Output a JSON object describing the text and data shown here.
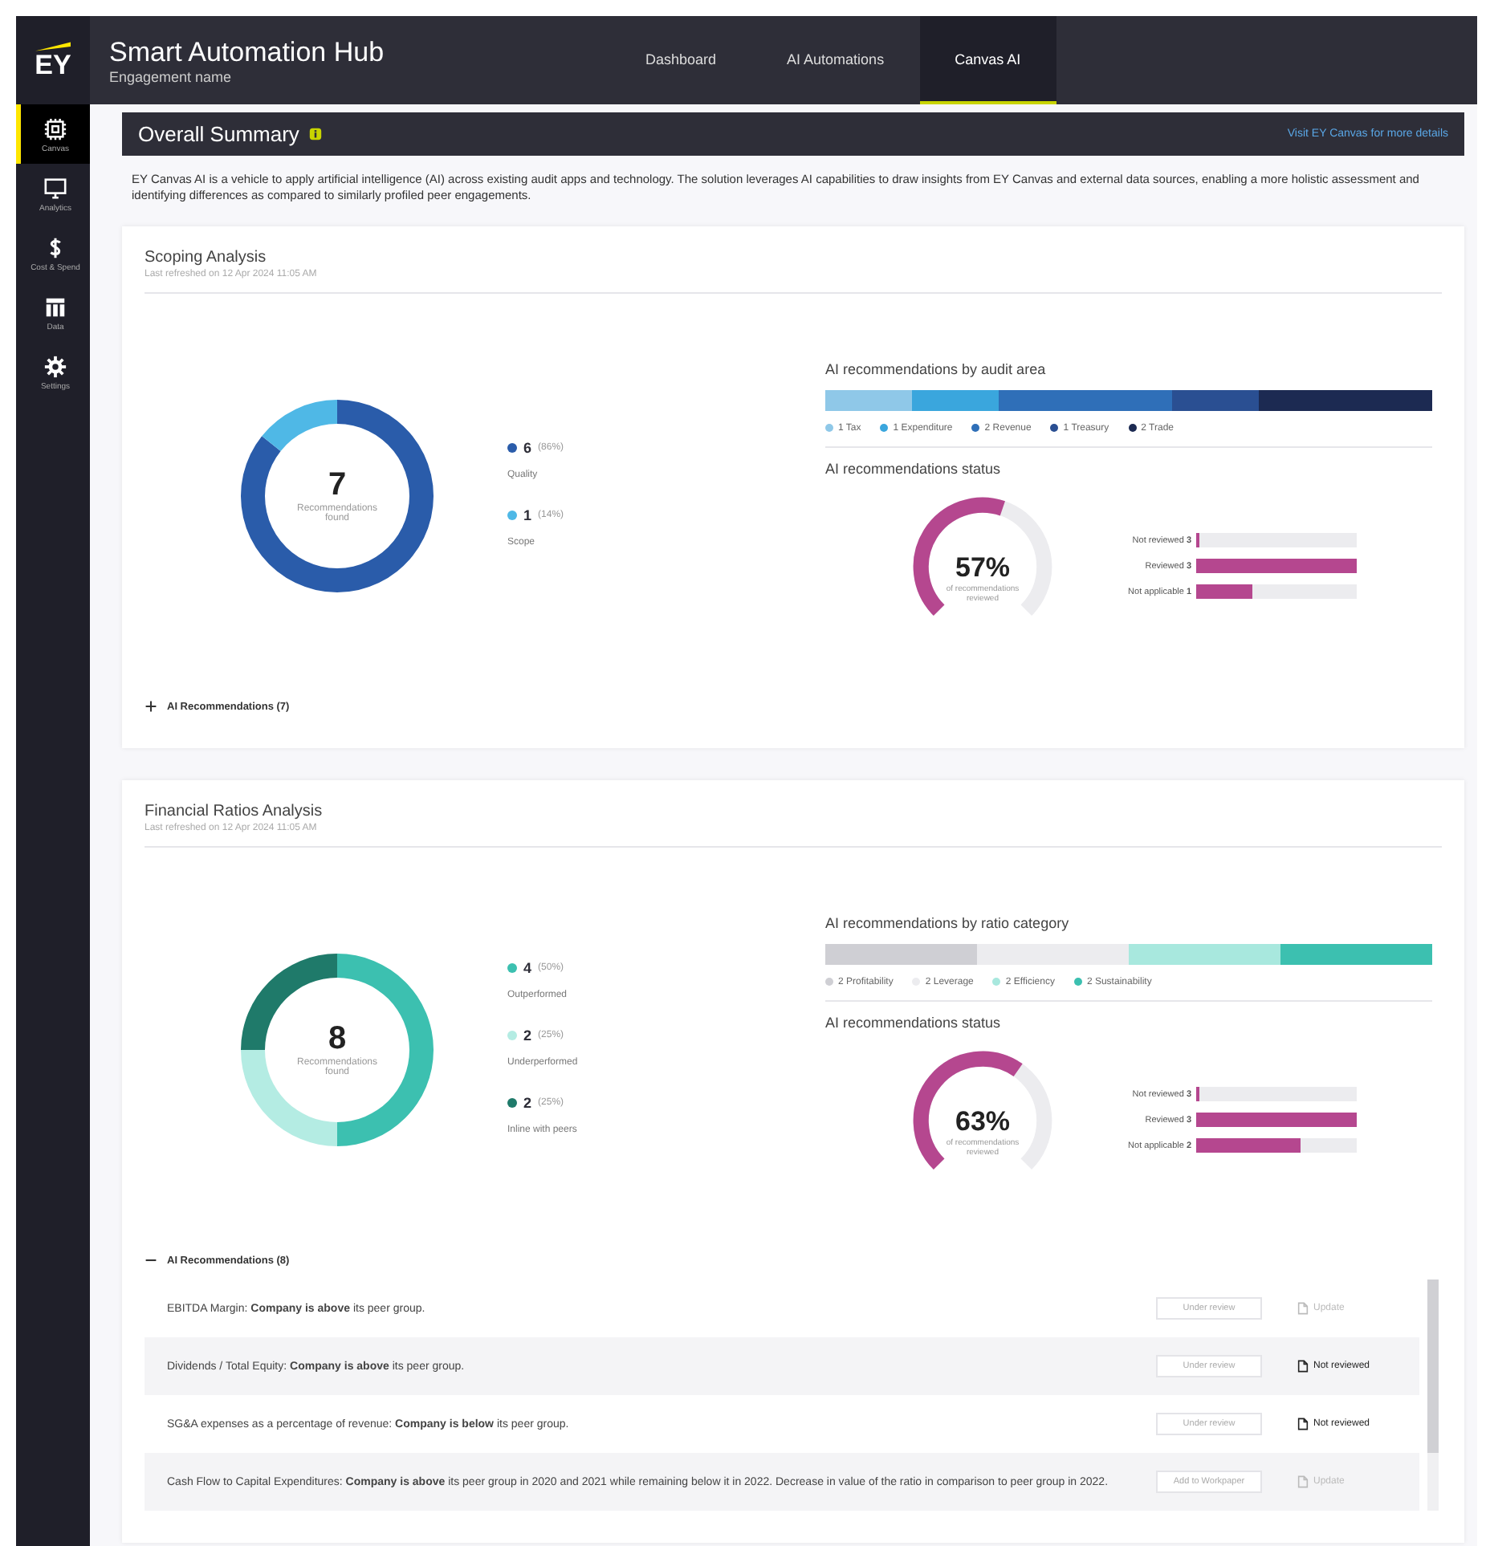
{
  "header": {
    "logo": "EY",
    "title": "Smart Automation Hub",
    "subtitle": "Engagement name",
    "tabs": [
      {
        "label": "Dashboard",
        "selected": false
      },
      {
        "label": "AI Automations",
        "selected": false
      },
      {
        "label": "Canvas AI",
        "selected": true
      }
    ]
  },
  "sidebar": {
    "items": [
      {
        "kind": "grid",
        "label": "Canvas",
        "selected": true
      },
      {
        "kind": "monitor",
        "label": "Analytics",
        "selected": false
      },
      {
        "kind": "dollar",
        "label": "Cost & Spend",
        "selected": false
      },
      {
        "kind": "table",
        "label": "Data",
        "selected": false
      },
      {
        "kind": "gear",
        "label": "Settings",
        "selected": false
      }
    ]
  },
  "summary": {
    "title": "Overall Summary",
    "link": "Visit EY Canvas for more details",
    "description": "EY Canvas AI is a vehicle to apply artificial intelligence (AI) across existing audit apps and technology. The solution leverages AI capabilities to draw insights from EY Canvas and external data sources, enabling a more holistic assessment and identifying differences as compared to similarly profiled peer engagements."
  },
  "sections": [
    {
      "title": "Scoping Analysis",
      "subtitle": "Last refreshed on 12 Apr 2024 11:05 AM",
      "donut": {
        "total": "7",
        "caption": "Recommendations found",
        "legend": [
          {
            "count": "6",
            "percent": "(86%)",
            "label": "Quality",
            "color": "#2a5caa"
          },
          {
            "count": "1",
            "percent": "(14%)",
            "label": "Scope",
            "color": "#4fb8e6"
          }
        ]
      },
      "category_chart": {
        "title": "AI recommendations by audit area",
        "legend": [
          {
            "count": "1",
            "label": "Tax",
            "color": "#8fc8e8"
          },
          {
            "count": "1",
            "label": "Expenditure",
            "color": "#3aa6dd"
          },
          {
            "count": "2",
            "label": "Revenue",
            "color": "#2f6fb8"
          },
          {
            "count": "1",
            "label": "Treasury",
            "color": "#2a4f92"
          },
          {
            "count": "2",
            "label": "Trade",
            "color": "#1c2a52"
          }
        ]
      },
      "status": {
        "title": "AI recommendations status",
        "percent": "57%",
        "caption": "of recommendations reviewed",
        "bars": [
          {
            "label": "Not reviewed",
            "count": "3",
            "level": 0.02
          },
          {
            "label": "Reviewed",
            "count": "3",
            "level": 1
          },
          {
            "label": "Not applicable",
            "count": "1",
            "level": 0.35
          }
        ]
      },
      "recommendations": {
        "label": "AI Recommendations (7)",
        "expanded": false
      }
    },
    {
      "title": "Financial Ratios Analysis",
      "subtitle": "Last refreshed on 12 Apr 2024 11:05 AM",
      "donut": {
        "total": "8",
        "caption": "Recommendations found",
        "legend": [
          {
            "count": "4",
            "percent": "(50%)",
            "label": "Outperformed",
            "color": "#3cc0b0"
          },
          {
            "count": "2",
            "percent": "(25%)",
            "label": "Underperformed",
            "color": "#b4ece3"
          },
          {
            "count": "2",
            "percent": "(25%)",
            "label": "Inline with peers",
            "color": "#1f7a6a"
          }
        ]
      },
      "category_chart": {
        "title": "AI recommendations by ratio category",
        "legend": [
          {
            "count": "2",
            "label": "Profitability",
            "color": "#cfcfd4"
          },
          {
            "count": "2",
            "label": "Leverage",
            "color": "#ececef"
          },
          {
            "count": "2",
            "label": "Efficiency",
            "color": "#a8e8de"
          },
          {
            "count": "2",
            "label": "Sustainability",
            "color": "#3cc0b0"
          }
        ]
      },
      "status": {
        "title": "AI recommendations status",
        "percent": "63%",
        "caption": "of recommendations reviewed",
        "bars": [
          {
            "label": "Not reviewed",
            "count": "3",
            "level": 0.02
          },
          {
            "label": "Reviewed",
            "count": "3",
            "level": 1
          },
          {
            "label": "Not applicable",
            "count": "2",
            "level": 0.65
          }
        ]
      },
      "recommendations": {
        "label": "AI Recommendations (8)",
        "expanded": true,
        "rows": [
          {
            "text": "EBITDA Margin: **Company is above** its peer group.",
            "status": "Under review",
            "action": "Update",
            "disabled": true
          },
          {
            "text": "Dividends / Total Equity: **Company is above** its peer group.",
            "status": "Under review",
            "action": "Not reviewed",
            "disabled": false
          },
          {
            "text": "SG&A expenses as a percentage of revenue: **Company is below** its peer group.",
            "status": "Under review",
            "action": "Not reviewed",
            "disabled": false
          },
          {
            "text": "Cash Flow to Capital Expenditures: **Company is above** its peer group in 2020 and 2021 while remaining below it in 2022. Decrease in value of the ratio in comparison to peer group in 2022.",
            "status": "Add to Workpaper",
            "action": "Update",
            "disabled": true
          }
        ]
      }
    }
  ]
}
